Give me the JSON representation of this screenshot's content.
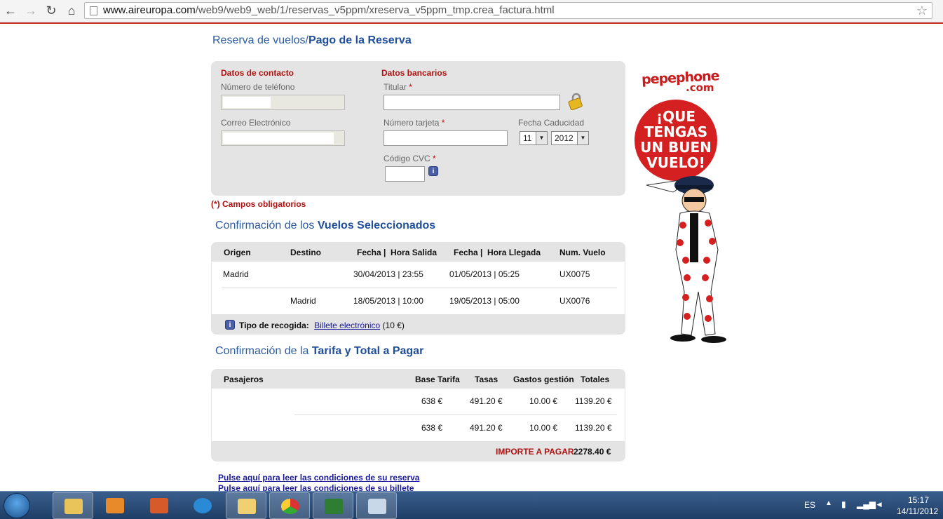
{
  "browser": {
    "url_domain": "www.aireuropa.com",
    "url_path": "/web9/web9_web/1/reservas_v5ppm/xreserva_v5ppm_tmp.crea_factura.html"
  },
  "breadcrumb": {
    "part1": "Reserva de vuelos/",
    "part2": "Pago de la Reserva"
  },
  "contact": {
    "title": "Datos de contacto",
    "phone_label": "Número de teléfono",
    "email_label": "Correo Electrónico"
  },
  "bank": {
    "title": "Datos bancarios",
    "holder_label": "Titular",
    "card_label": "Número tarjeta",
    "expiry_label": "Fecha Caducidad",
    "expiry_month": "11",
    "expiry_year": "2012",
    "cvc_label": "Código CVC",
    "required_mark": "*"
  },
  "mandatory_note": "(*) Campos obligatorios",
  "flights": {
    "heading_pre": "Confirmación de los ",
    "heading_bold": "Vuelos Seleccionados",
    "headers": [
      "Origen",
      "Destino",
      "Fecha |  Hora Salida",
      "Fecha |  Hora Llegada",
      "Num. Vuelo"
    ],
    "rows": [
      {
        "origin": "Madrid",
        "destination": "",
        "departure": "30/04/2013 | 23:55",
        "arrival": "01/05/2013 | 05:25",
        "flight": "UX0075"
      },
      {
        "origin": "",
        "destination": "Madrid",
        "departure": "18/05/2013 | 10:00",
        "arrival": "19/05/2013 | 05:00",
        "flight": "UX0076"
      }
    ],
    "pickup_label": "Tipo de recogida:",
    "pickup_link": "Billete electrónico",
    "pickup_price": "(10 €)"
  },
  "fare": {
    "heading_pre": "Confirmación de la ",
    "heading_bold": "Tarifa y Total a Pagar",
    "headers": [
      "Pasajeros",
      "Base Tarifa",
      "Tasas",
      "Gastos gestión",
      "Totales"
    ],
    "rows": [
      {
        "base": "638 €",
        "taxes": "491.20 €",
        "fees": "10.00 €",
        "total": "1139.20 €"
      },
      {
        "base": "638 €",
        "taxes": "491.20 €",
        "fees": "10.00 €",
        "total": "1139.20 €"
      }
    ],
    "total_label": "IMPORTE A PAGAR",
    "total_value": "2278.40 €"
  },
  "conditions": {
    "booking_link": "Pulse aquí para leer las condiciones de su reserva",
    "ticket_link": "Pulse aquí para leer las condiciones de su billete"
  },
  "ad": {
    "logo_main": "pepephone",
    "logo_sub": ".com",
    "slogan_lines": [
      "¡QUE",
      "TENGAS",
      "UN BUEN",
      "VUELO!"
    ]
  },
  "taskbar": {
    "language": "ES",
    "time": "15:17",
    "date": "14/11/2012"
  },
  "colors": {
    "brand_blue": "#1f4e9a",
    "accent_red": "#b01212",
    "panel_gray": "#e4e4e4"
  }
}
